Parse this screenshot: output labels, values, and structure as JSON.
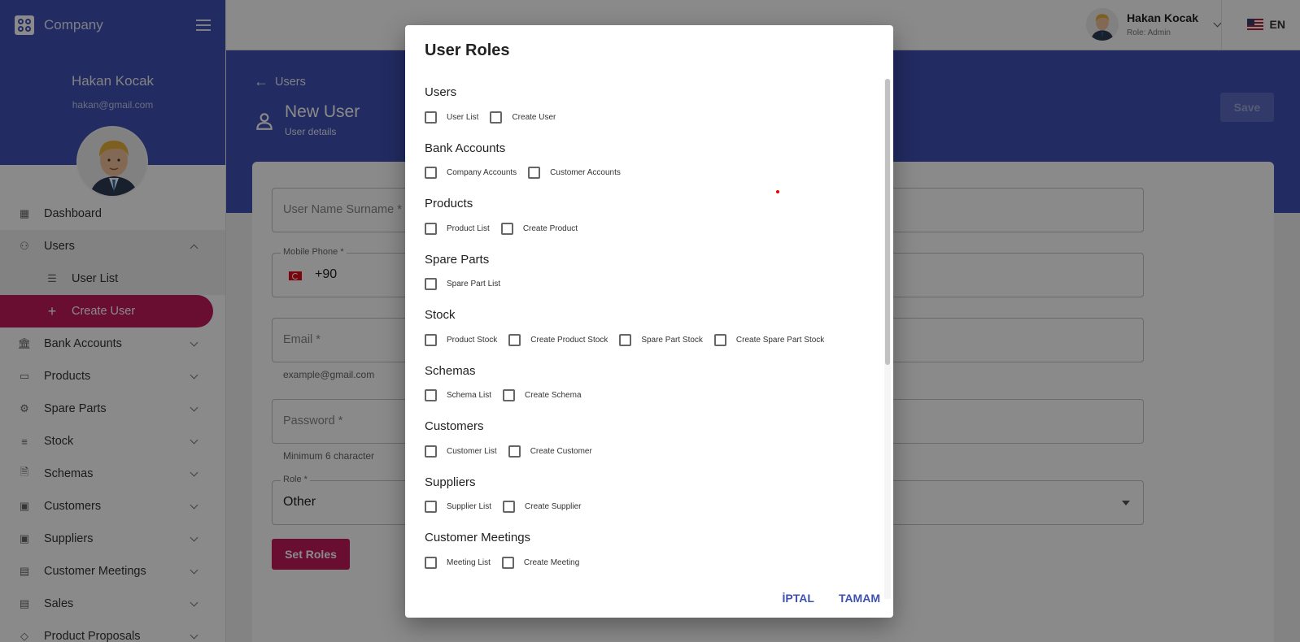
{
  "sidebar": {
    "brand": "Company",
    "user_name": "Hakan Kocak",
    "user_email": "hakan@gmail.com",
    "menu": [
      {
        "label": "Dashboard",
        "icon": "dashboard-icon"
      },
      {
        "label": "Users",
        "icon": "person-icon"
      },
      {
        "label": "User List",
        "icon": "list-icon"
      },
      {
        "label": "Create User",
        "icon": "plus-icon"
      },
      {
        "label": "Bank Accounts",
        "icon": "bank-icon"
      },
      {
        "label": "Products",
        "icon": "devices-icon"
      },
      {
        "label": "Spare Parts",
        "icon": "gear-icon"
      },
      {
        "label": "Stock",
        "icon": "list-icon"
      },
      {
        "label": "Schemas",
        "icon": "document-icon"
      },
      {
        "label": "Customers",
        "icon": "contact-icon"
      },
      {
        "label": "Suppliers",
        "icon": "contact-icon"
      },
      {
        "label": "Customer Meetings",
        "icon": "chat-icon"
      },
      {
        "label": "Sales",
        "icon": "receipt-icon"
      },
      {
        "label": "Product Proposals",
        "icon": "tag-icon"
      }
    ]
  },
  "header": {
    "user_name": "Hakan Kocak",
    "user_role": "Role: Admin",
    "language": "EN"
  },
  "page": {
    "breadcrumb": "Users",
    "title": "New User",
    "subtitle": "User details",
    "save_label": "Save"
  },
  "form": {
    "name_placeholder": "User Name Surname *",
    "phone_label": "Mobile Phone *",
    "phone_value": "+90",
    "email_placeholder": "Email *",
    "email_helper": "example@gmail.com",
    "password_placeholder": "Password *",
    "password_helper": "Minimum 6 character",
    "role_label": "Role *",
    "role_value": "Other",
    "set_roles_label": "Set Roles"
  },
  "dialog": {
    "title": "User Roles",
    "groups": [
      {
        "title": "Users",
        "items": [
          "User List",
          "Create User"
        ]
      },
      {
        "title": "Bank Accounts",
        "items": [
          "Company Accounts",
          "Customer Accounts"
        ]
      },
      {
        "title": "Products",
        "items": [
          "Product List",
          "Create Product"
        ]
      },
      {
        "title": "Spare Parts",
        "items": [
          "Spare Part List"
        ]
      },
      {
        "title": "Stock",
        "items": [
          "Product Stock",
          "Create Product Stock",
          "Spare Part Stock",
          "Create Spare Part Stock"
        ]
      },
      {
        "title": "Schemas",
        "items": [
          "Schema List",
          "Create Schema"
        ]
      },
      {
        "title": "Customers",
        "items": [
          "Customer List",
          "Create Customer"
        ]
      },
      {
        "title": "Suppliers",
        "items": [
          "Supplier List",
          "Create Supplier"
        ]
      },
      {
        "title": "Customer Meetings",
        "items": [
          "Meeting List",
          "Create Meeting"
        ]
      }
    ],
    "cancel_label": "İPTAL",
    "ok_label": "TAMAM"
  },
  "colors": {
    "primary": "#3f51b5",
    "accent": "#c2185b"
  }
}
